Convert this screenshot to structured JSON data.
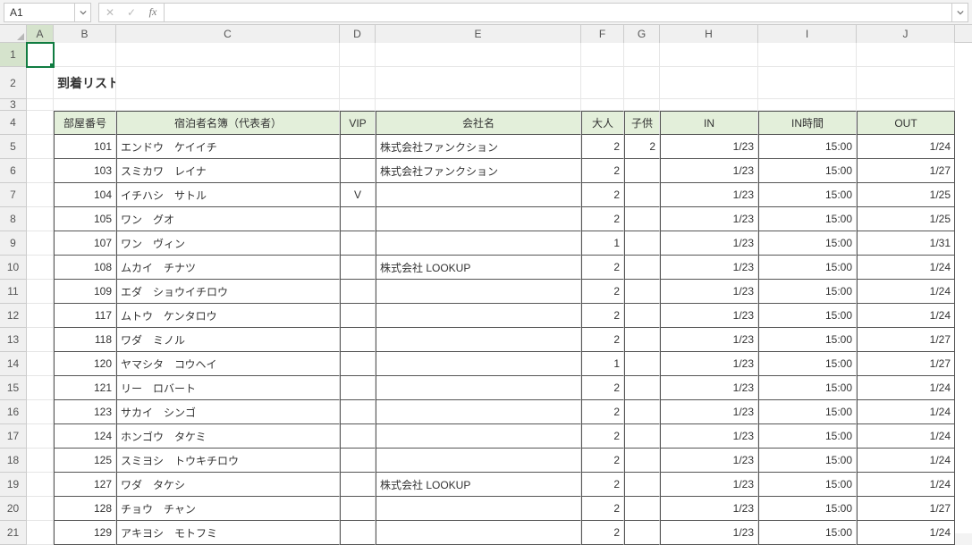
{
  "nameBox": "A1",
  "formula": "",
  "columns": [
    "A",
    "B",
    "C",
    "D",
    "E",
    "F",
    "G",
    "H",
    "I",
    "J"
  ],
  "rowNumbers": [
    1,
    2,
    3,
    4,
    5,
    6,
    7,
    8,
    9,
    10,
    11,
    12,
    13,
    14,
    15,
    16,
    17,
    18,
    19,
    20,
    21
  ],
  "title": "到着リスト",
  "headers": {
    "room": "部屋番号",
    "guest": "宿泊者名簿（代表者）",
    "vip": "VIP",
    "company": "会社名",
    "adults": "大人",
    "children": "子供",
    "in": "IN",
    "inTime": "IN時間",
    "out": "OUT"
  },
  "rows": [
    {
      "room": "101",
      "guest": "エンドウ　ケイイチ",
      "vip": "",
      "company": "株式会社ファンクション",
      "ad": "2",
      "ch": "2",
      "in": "1/23",
      "intime": "15:00",
      "out": "1/24"
    },
    {
      "room": "103",
      "guest": "スミカワ　レイナ",
      "vip": "",
      "company": "株式会社ファンクション",
      "ad": "2",
      "ch": "",
      "in": "1/23",
      "intime": "15:00",
      "out": "1/27"
    },
    {
      "room": "104",
      "guest": "イチハシ　サトル",
      "vip": "V",
      "company": "",
      "ad": "2",
      "ch": "",
      "in": "1/23",
      "intime": "15:00",
      "out": "1/25"
    },
    {
      "room": "105",
      "guest": "ワン　グオ",
      "vip": "",
      "company": "",
      "ad": "2",
      "ch": "",
      "in": "1/23",
      "intime": "15:00",
      "out": "1/25"
    },
    {
      "room": "107",
      "guest": "ワン　ヴィン",
      "vip": "",
      "company": "",
      "ad": "1",
      "ch": "",
      "in": "1/23",
      "intime": "15:00",
      "out": "1/31"
    },
    {
      "room": "108",
      "guest": "ムカイ　チナツ",
      "vip": "",
      "company": "株式会社 LOOKUP",
      "ad": "2",
      "ch": "",
      "in": "1/23",
      "intime": "15:00",
      "out": "1/24"
    },
    {
      "room": "109",
      "guest": "エダ　ショウイチロウ",
      "vip": "",
      "company": "",
      "ad": "2",
      "ch": "",
      "in": "1/23",
      "intime": "15:00",
      "out": "1/24"
    },
    {
      "room": "117",
      "guest": "ムトウ　ケンタロウ",
      "vip": "",
      "company": "",
      "ad": "2",
      "ch": "",
      "in": "1/23",
      "intime": "15:00",
      "out": "1/24"
    },
    {
      "room": "118",
      "guest": "ワダ　ミノル",
      "vip": "",
      "company": "",
      "ad": "2",
      "ch": "",
      "in": "1/23",
      "intime": "15:00",
      "out": "1/27"
    },
    {
      "room": "120",
      "guest": "ヤマシタ　コウヘイ",
      "vip": "",
      "company": "",
      "ad": "1",
      "ch": "",
      "in": "1/23",
      "intime": "15:00",
      "out": "1/27"
    },
    {
      "room": "121",
      "guest": "リー　ロバート",
      "vip": "",
      "company": "",
      "ad": "2",
      "ch": "",
      "in": "1/23",
      "intime": "15:00",
      "out": "1/24"
    },
    {
      "room": "123",
      "guest": "サカイ　シンゴ",
      "vip": "",
      "company": "",
      "ad": "2",
      "ch": "",
      "in": "1/23",
      "intime": "15:00",
      "out": "1/24"
    },
    {
      "room": "124",
      "guest": "ホンゴウ　タケミ",
      "vip": "",
      "company": "",
      "ad": "2",
      "ch": "",
      "in": "1/23",
      "intime": "15:00",
      "out": "1/24"
    },
    {
      "room": "125",
      "guest": "スミヨシ　トウキチロウ",
      "vip": "",
      "company": "",
      "ad": "2",
      "ch": "",
      "in": "1/23",
      "intime": "15:00",
      "out": "1/24"
    },
    {
      "room": "127",
      "guest": "ワダ　タケシ",
      "vip": "",
      "company": "株式会社 LOOKUP",
      "ad": "2",
      "ch": "",
      "in": "1/23",
      "intime": "15:00",
      "out": "1/24"
    },
    {
      "room": "128",
      "guest": "チョウ　チャン",
      "vip": "",
      "company": "",
      "ad": "2",
      "ch": "",
      "in": "1/23",
      "intime": "15:00",
      "out": "1/27"
    },
    {
      "room": "129",
      "guest": "アキヨシ　モトフミ",
      "vip": "",
      "company": "",
      "ad": "2",
      "ch": "",
      "in": "1/23",
      "intime": "15:00",
      "out": "1/24"
    }
  ]
}
